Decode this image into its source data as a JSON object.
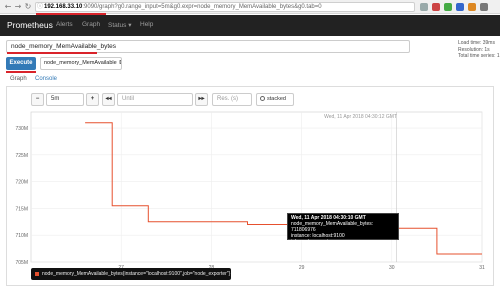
{
  "browser": {
    "url_host": "192.168.33.10",
    "url_rest": ":9090/graph?g0.range_input=5m&g0.expr=node_memory_MemAvailable_bytes&g0.tab=0",
    "back_icon": "arrow-left-icon",
    "forward_icon": "arrow-right-icon",
    "reload_icon": "reload-icon",
    "lock_icon": "info-icon"
  },
  "navbar": {
    "brand": "Prometheus",
    "links": [
      "Alerts",
      "Graph",
      "Status ▾",
      "Help"
    ]
  },
  "query": {
    "expression": "node_memory_MemAvailable_bytes",
    "execute_label": "Execute",
    "metric_select": "node_memory_MemAvailable ⇕",
    "stats": [
      "Load time: 39ms",
      "Resolution: 1s",
      "Total time series: 1"
    ]
  },
  "tabs": {
    "graph": "Graph",
    "console": "Console"
  },
  "controls": {
    "minus": "−",
    "range": "5m",
    "plus": "+",
    "back": "◂◂",
    "until_placeholder": "Until",
    "forward": "▸▸",
    "res_placeholder": "Res. (s)",
    "stacked": "stacked"
  },
  "chart_data": {
    "type": "line",
    "y_ticks": [
      "730M",
      "725M",
      "720M",
      "715M",
      "710M",
      "705M"
    ],
    "x_ticks": [
      "27",
      "28",
      "29",
      "30",
      "31"
    ],
    "hover_label": "Wed, 11 Apr 2018 04:30:12 GMT",
    "series": [
      {
        "name": "node_memory_MemAvailable_bytes{instance=\"localhost:9100\",job=\"node_exporter\"}",
        "color": "#e6502e",
        "points": [
          [
            26.6,
            731
          ],
          [
            26.9,
            731
          ],
          [
            26.9,
            715.5
          ],
          [
            27.3,
            715.5
          ],
          [
            27.3,
            712.5
          ],
          [
            28.4,
            712.5
          ],
          [
            28.4,
            712
          ],
          [
            29.7,
            712
          ],
          [
            29.7,
            711.7
          ],
          [
            30.0,
            711.7
          ],
          [
            30.0,
            711.3
          ],
          [
            30.5,
            711.3
          ],
          [
            30.5,
            706.5
          ],
          [
            31.0,
            706.5
          ]
        ]
      }
    ],
    "ylim": [
      705,
      733
    ],
    "xlim": [
      26.0,
      31.0
    ]
  },
  "tooltip": {
    "time": "Wed, 11 Apr 2018 04:30:10 GMT",
    "value": "node_memory_MemAvailable_bytes: 711806976",
    "instance": "instance: localhost:9100",
    "job": "job: node_exporter"
  },
  "legend": {
    "text": "node_memory_MemAvailable_bytes{instance=\"localhost:9100\",job=\"node_exporter\"}"
  }
}
